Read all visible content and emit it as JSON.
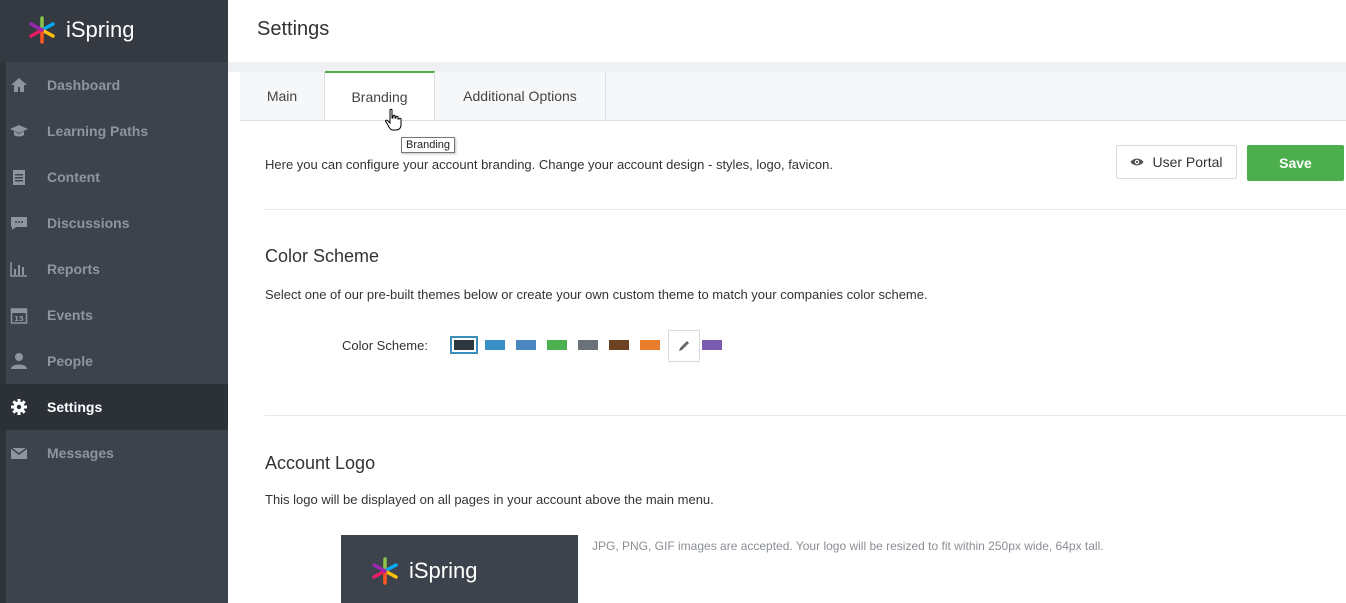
{
  "app": {
    "name": "iSpring"
  },
  "sidebar": {
    "items": [
      {
        "label": "Dashboard",
        "icon": "home-icon"
      },
      {
        "label": "Learning Paths",
        "icon": "graduation-cap-icon"
      },
      {
        "label": "Content",
        "icon": "clipboard-icon"
      },
      {
        "label": "Discussions",
        "icon": "chat-icon"
      },
      {
        "label": "Reports",
        "icon": "bar-chart-icon"
      },
      {
        "label": "Events",
        "icon": "calendar-icon"
      },
      {
        "label": "People",
        "icon": "person-icon"
      },
      {
        "label": "Settings",
        "icon": "gear-icon",
        "active": true
      },
      {
        "label": "Messages",
        "icon": "envelope-icon"
      }
    ]
  },
  "header": {
    "title": "Settings"
  },
  "tabs": [
    {
      "label": "Main"
    },
    {
      "label": "Branding",
      "active": true
    },
    {
      "label": "Additional Options"
    }
  ],
  "tooltip": "Branding",
  "branding": {
    "intro": "Here you can configure your account branding. Change your account design - styles, logo, favicon.",
    "user_portal_label": "User Portal",
    "save_label": "Save"
  },
  "color_scheme": {
    "heading": "Color Scheme",
    "description": "Select one of our pre-built themes below or create your own custom theme to match your companies color scheme.",
    "label": "Color Scheme:",
    "swatches": [
      "#2e3740",
      "#3a8fc9",
      "#4a86c0",
      "#4caf50",
      "#6b7178",
      "#6d4222",
      "#e87d2c",
      "#e53935",
      "#7b5bb0"
    ],
    "selected_index": 0
  },
  "account_logo": {
    "heading": "Account Logo",
    "description": "This logo will be displayed on all pages in your account above the main menu.",
    "accepted_note": "JPG, PNG, GIF images are accepted. Your logo will be resized to fit within 250px wide, 64px tall."
  },
  "colors": {
    "accent_green": "#4cae4c",
    "sidebar_bg": "#3d434c"
  }
}
